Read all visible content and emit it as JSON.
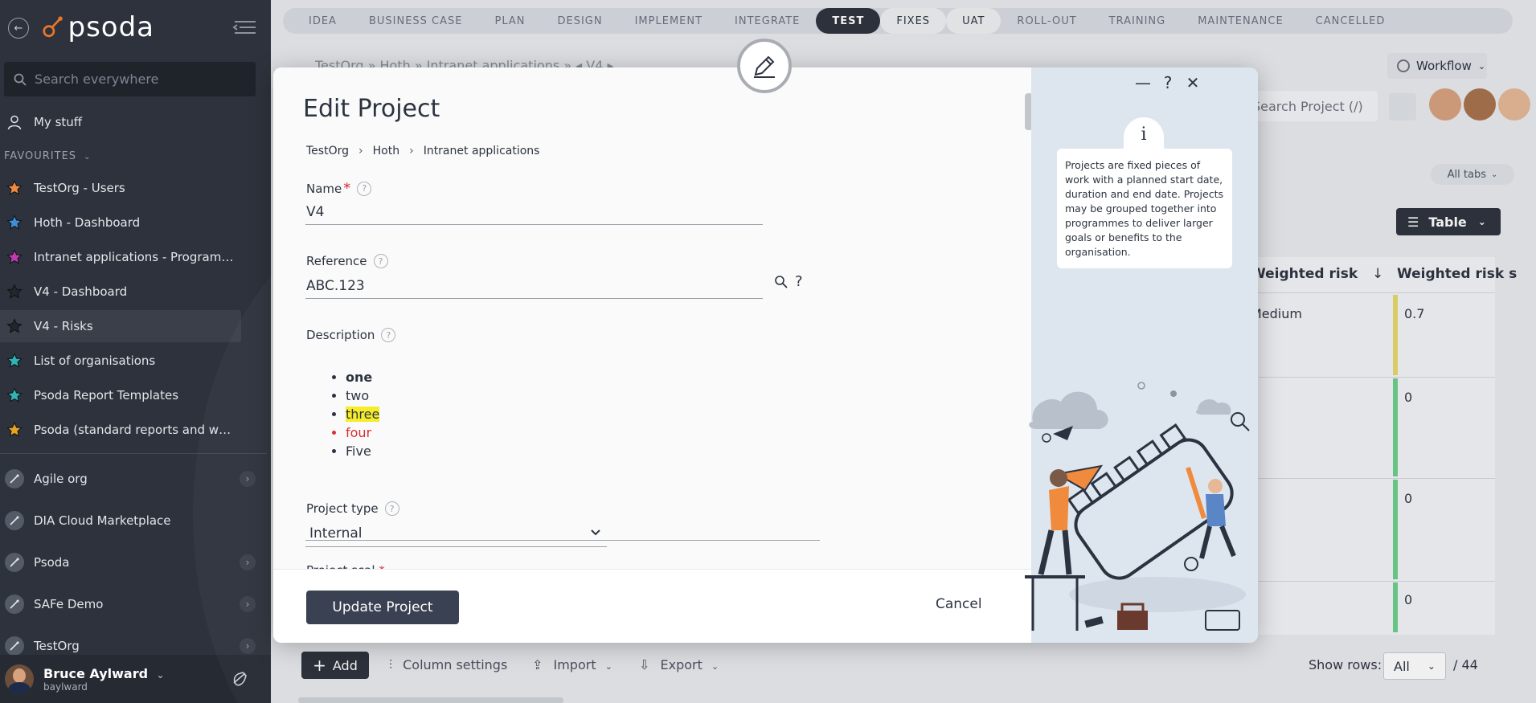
{
  "sidebar": {
    "logo_text": "psoda",
    "search_placeholder": "Search everywhere",
    "my_stuff": "My stuff",
    "favourites_label": "FAVOURITES",
    "favourites": [
      {
        "label": "TestOrg - Users",
        "color": "#f08a3c"
      },
      {
        "label": "Hoth - Dashboard",
        "color": "#3f8fd6"
      },
      {
        "label": "Intranet applications - Programme...",
        "color": "#c03bb3"
      },
      {
        "label": "V4 - Dashboard",
        "color": "#22262d"
      },
      {
        "label": "V4 - Risks",
        "color": "#22262d"
      },
      {
        "label": "List of organisations",
        "color": "#2fb4b7"
      },
      {
        "label": "Psoda Report Templates",
        "color": "#2fb4b7"
      },
      {
        "label": "Psoda (standard reports and work...",
        "color": "#e5a426"
      }
    ],
    "orgs": [
      {
        "label": "Agile org"
      },
      {
        "label": "DIA Cloud Marketplace"
      },
      {
        "label": "Psoda"
      },
      {
        "label": "SAFe Demo"
      },
      {
        "label": "TestOrg"
      }
    ],
    "user": {
      "name": "Bruce Aylward",
      "login": "baylward"
    }
  },
  "stages": [
    "IDEA",
    "BUSINESS CASE",
    "PLAN",
    "DESIGN",
    "IMPLEMENT",
    "INTEGRATE",
    "TEST",
    "FIXES",
    "UAT",
    "ROLL-OUT",
    "TRAINING",
    "MAINTENANCE",
    "CANCELLED"
  ],
  "background": {
    "breadcrumb": "TestOrg  »  Hoth  »  Intranet applications  »  ◂ V4 ▸",
    "workflow_label": "Workflow",
    "search_placeholder": "Search Project (/)",
    "all_tabs": "All tabs",
    "table_btn": "Table",
    "col_weighted_risk": "Weighted risk",
    "col_weighted_risk_score": "Weighted risk s",
    "rows": [
      {
        "risk": "Medium",
        "score": "0.7",
        "bar": "#e8d86a"
      },
      {
        "risk": "",
        "score": "0",
        "bar": "#6ccf8a"
      },
      {
        "risk": "",
        "score": "0",
        "bar": "#6ccf8a"
      },
      {
        "risk": "",
        "score": "0",
        "bar": "#6ccf8a"
      }
    ],
    "add": "Add",
    "column_settings": "Column settings",
    "import": "Import",
    "export": "Export",
    "show_rows": "Show rows:",
    "rows_value": "All",
    "rows_total": "/ 44"
  },
  "modal": {
    "title": "Edit Project",
    "breadcrumb": [
      "TestOrg",
      "Hoth",
      "Intranet applications"
    ],
    "name_label": "Name",
    "name_value": "V4",
    "reference_label": "Reference",
    "reference_value": "ABC.123",
    "description_label": "Description",
    "description_items": [
      "one",
      "two",
      "three",
      "four",
      "Five"
    ],
    "project_type_label": "Project type",
    "project_type_value": "Internal",
    "next_label": "Project scal",
    "update_button": "Update Project",
    "cancel_button": "Cancel",
    "info_text": "Projects are fixed pieces of work with a planned start date, duration and end date. Projects may be grouped together into programmes to deliver larger goals or benefits to the organisation.",
    "info_icon": "i",
    "help_char": "?"
  }
}
